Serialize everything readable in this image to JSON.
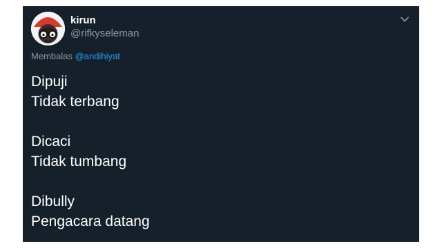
{
  "tweet": {
    "author": {
      "name": "kirun",
      "handle": "@rifkyseleman",
      "avatar_icon": "cartoon-avatar-with-glasses"
    },
    "reply": {
      "prefix": "Membalas",
      "handle": "@andihiyat"
    },
    "menu_icon": "chevron-down-icon",
    "stanzas": [
      [
        "Dipuji",
        "Tidak terbang"
      ],
      [
        "Dicaci",
        "Tidak tumbang"
      ],
      [
        "Dibully",
        "Pengacara datang"
      ]
    ]
  },
  "colors": {
    "background": "#15202b",
    "text": "#ffffff",
    "secondary": "#8899a6",
    "link": "#1da1f2",
    "avatar_hat": "#d93a2b"
  }
}
